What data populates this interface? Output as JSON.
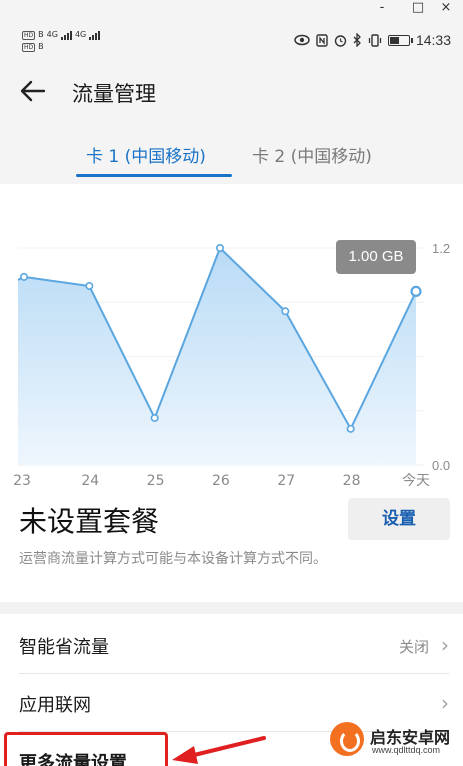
{
  "window_controls": {
    "minimize": "-",
    "maximize": "□",
    "close": "×"
  },
  "status_bar": {
    "sim1": {
      "badge": "HD",
      "sub": "B",
      "network": "4G"
    },
    "sim2": {
      "badge": "HD",
      "sub": "B",
      "network": "4G"
    },
    "time": "14:33",
    "battery_level": 0.55,
    "icons": [
      "eye-icon",
      "nfc-icon",
      "alarm-icon",
      "bluetooth-icon",
      "vibrate-icon",
      "battery-icon"
    ]
  },
  "header": {
    "title": "流量管理"
  },
  "tabs": [
    {
      "label": "卡 1 (中国移动)",
      "active": true
    },
    {
      "label": "卡 2 (中国移动)",
      "active": false
    }
  ],
  "chart_data": {
    "type": "area",
    "categories": [
      "23",
      "24",
      "25",
      "26",
      "27",
      "28",
      "今天"
    ],
    "values": [
      1.04,
      0.99,
      0.26,
      1.2,
      0.85,
      0.2,
      0.96
    ],
    "y_ticks": [
      "1.2",
      "0.0"
    ],
    "ylim": [
      0,
      1.2
    ],
    "tooltip": "1.00 GB",
    "colors": {
      "line": "#5aa6e0",
      "fill_top": "#b9dbf6",
      "fill_bottom": "#eef6fd"
    }
  },
  "plan": {
    "title": "未设置套餐",
    "button": "设置",
    "note": "运营商流量计算方式可能与本设备计算方式不同。"
  },
  "list": [
    {
      "label": "智能省流量",
      "value": "关闭"
    },
    {
      "label": "应用联网",
      "value": ""
    },
    {
      "label": "更多流量设置",
      "value": ""
    }
  ],
  "watermark": {
    "name": "启东安卓网",
    "url": "www.qdlttdq.com"
  }
}
